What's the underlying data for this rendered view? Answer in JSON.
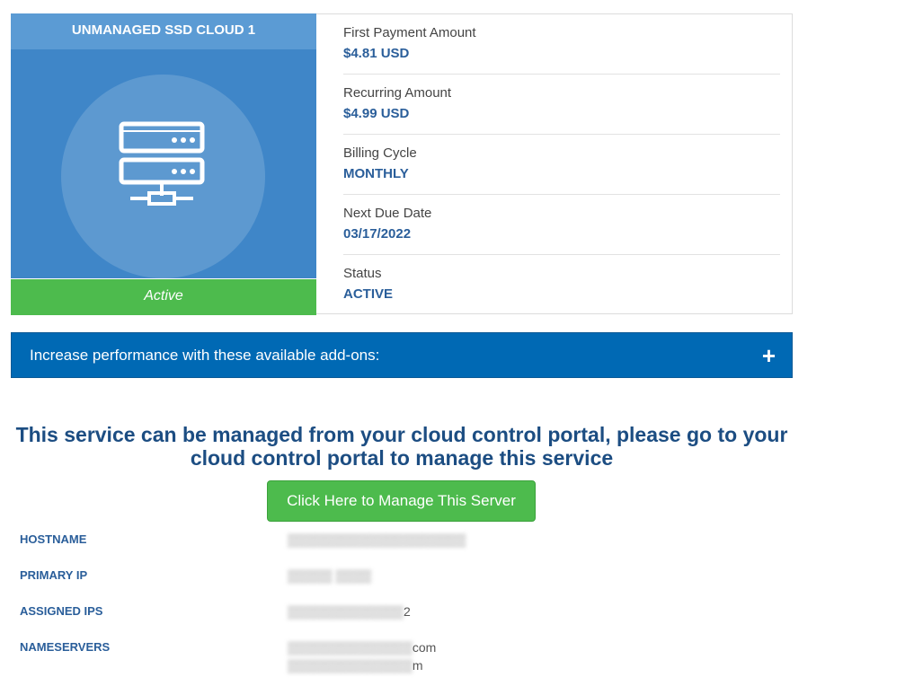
{
  "product": {
    "title": "UNMANAGED SSD CLOUD 1",
    "icon": "server-icon",
    "status": "Active"
  },
  "details": [
    {
      "label": "First Payment Amount",
      "value": "$4.81 USD"
    },
    {
      "label": "Recurring Amount",
      "value": "$4.99 USD"
    },
    {
      "label": "Billing Cycle",
      "value": "MONTHLY"
    },
    {
      "label": "Next Due Date",
      "value": "03/17/2022"
    },
    {
      "label": "Status",
      "value": "ACTIVE"
    }
  ],
  "addons": {
    "text": "Increase performance with these available add-ons:",
    "expand_icon": "+"
  },
  "manage": {
    "message": "This service can be managed from your cloud control portal, please go to your cloud control portal to manage this service",
    "button_label": "Click Here to Manage This Server"
  },
  "server_info": [
    {
      "label": "HOSTNAME",
      "value": ""
    },
    {
      "label": "PRIMARY IP",
      "value": ""
    },
    {
      "label": "ASSIGNED IPS",
      "value": "2"
    },
    {
      "label": "NAMESERVERS",
      "value": "com",
      "value2": "m"
    }
  ],
  "colors": {
    "accent_blue": "#0069b4",
    "panel_blue": "#3f86c8",
    "active_green": "#4dbb4d",
    "value_blue": "#2a5e9a"
  }
}
